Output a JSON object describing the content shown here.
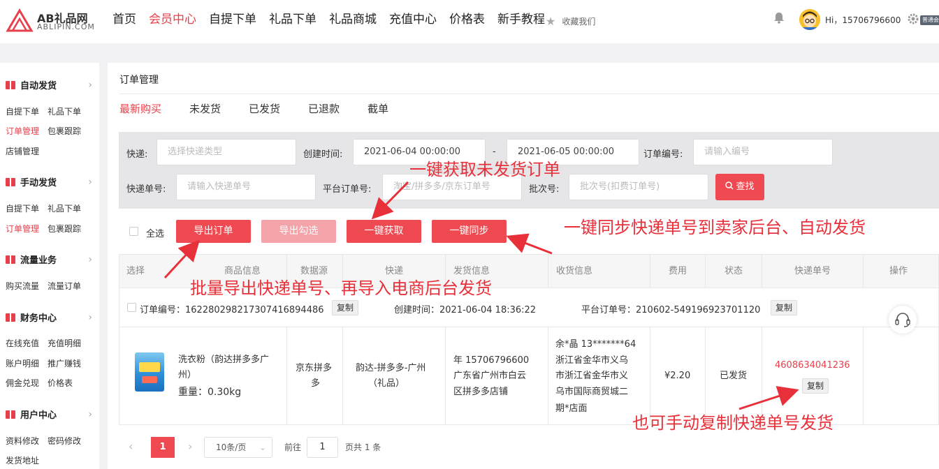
{
  "logo": {
    "title": "AB礼品网",
    "sub": "ABLIPIN.COM"
  },
  "nav": [
    "首页",
    "会员中心",
    "自提下单",
    "礼品下单",
    "礼品商城",
    "充值中心",
    "价格表",
    "新手教程"
  ],
  "favorite": "收藏我们",
  "user": {
    "greeting": "Hi，15706796600",
    "lang": "普通会员"
  },
  "sidebar": {
    "g1": "自动发货",
    "g1a": "自提下单",
    "g1b": "礼品下单",
    "g1c": "订单管理",
    "g1d": "包裹跟踪",
    "g1e": "店铺管理",
    "g2": "手动发货",
    "g2a": "自提下单",
    "g2b": "礼品下单",
    "g2c": "订单管理",
    "g2d": "包裹跟踪",
    "g3": "流量业务",
    "g3a": "购买流量",
    "g3b": "流量订单",
    "g4": "财务中心",
    "g4a": "在线充值",
    "g4b": "充值明细",
    "g4c": "账户明细",
    "g4d": "推广赚钱",
    "g4e": "佣金兑现",
    "g4f": "价格表",
    "g5": "用户中心",
    "g5a": "资料修改",
    "g5b": "密码修改",
    "g5c": "发货地址"
  },
  "page_title": "订单管理",
  "tabs": [
    "最新购买",
    "未发货",
    "已发货",
    "已退款",
    "截单"
  ],
  "filter": {
    "express_label": "快递:",
    "express_ph": "选择快递类型",
    "created_label": "创建时间:",
    "start": "2021-06-04 00:00:00",
    "dash": "-",
    "end": "2021-06-05 00:00:00",
    "order_no_label": "订单编号:",
    "order_no_ph": "请输入编号",
    "tracking_label": "快递单号:",
    "tracking_ph": "请输入快递单号",
    "platform_label": "平台订单号:",
    "platform_ph": "淘宝/拼多多/京东订单号",
    "batch_label": "批次号:",
    "batch_ph": "批次号(扣费订单号)",
    "search": "查找"
  },
  "actions": {
    "select_all": "全选",
    "export": "导出订单",
    "export_checked": "导出勾选",
    "fetch": "一键获取",
    "sync": "一键同步"
  },
  "columns": [
    "选择",
    "商品信息",
    "数据源",
    "快递",
    "发货信息",
    "收货信息",
    "费用",
    "状态",
    "快递单号",
    "操作"
  ],
  "order": {
    "order_no": "订单编号：16228029821730741689448​6",
    "copy1": "复制",
    "created": "创建时间：2021-06-04 18:36:22",
    "platform_no": "平台订单号：210602-549196923701120",
    "copy2": "复制",
    "product_name_1": "洗衣粉（韵达拼多多广",
    "product_name_2": "州）",
    "weight": "重量：0.30kg",
    "source_1": "京东拼多",
    "source_2": "多",
    "express_1": "韵达-拼多多-广州",
    "express_2": "（礼品）",
    "ship_1": "年 15706796600",
    "ship_2": "广东省广州市白云",
    "ship_3": "区拼多多店铺",
    "recv_1": "余*晶 13*******64",
    "recv_2": "浙江省金华市义乌",
    "recv_3": "市浙江省金华市义",
    "recv_4": "乌市国际商贸城二",
    "recv_5": "期*店面",
    "fee": "¥2.20",
    "status": "已发货",
    "tracking": "4608634041236",
    "copy3": "复制"
  },
  "pager": {
    "prev": "‹",
    "page": "1",
    "next": "›",
    "size": "10条/页",
    "goto": "前往",
    "goto_val": "1",
    "total": "页共 1 条"
  },
  "notes": {
    "fetch": "一键获取未发货订单",
    "sync": "一键同步快递单号到卖家后台、自动发货",
    "export": "批量导出快递单号、再导入电商后台发货",
    "copy": "也可手动复制快递单号发货"
  },
  "colors": {
    "accent": "#e8404a",
    "annotation": "#e8303a"
  }
}
